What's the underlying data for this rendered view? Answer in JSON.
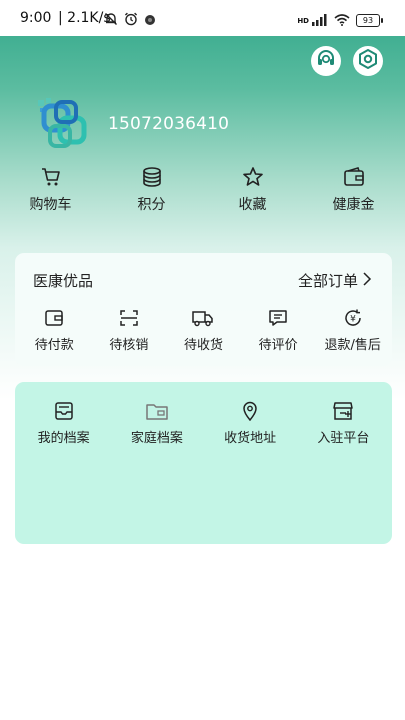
{
  "status_bar": {
    "time": "9:00",
    "speed": "| 2.1K/s",
    "network_label": "HD",
    "battery": "93"
  },
  "profile": {
    "phone": "15072036410"
  },
  "quick_links": [
    {
      "label": "购物车",
      "icon": "cart-icon"
    },
    {
      "label": "积分",
      "icon": "coins-icon"
    },
    {
      "label": "收藏",
      "icon": "star-icon"
    },
    {
      "label": "健康金",
      "icon": "wallet-icon"
    }
  ],
  "orders": {
    "title": "医康优品",
    "all_label": "全部订单",
    "items": [
      {
        "label": "待付款",
        "icon": "wallet-icon"
      },
      {
        "label": "待核销",
        "icon": "scan-icon"
      },
      {
        "label": "待收货",
        "icon": "truck-icon"
      },
      {
        "label": "待评价",
        "icon": "comment-icon"
      },
      {
        "label": "退款/售后",
        "icon": "refund-icon"
      }
    ]
  },
  "archive": {
    "items": [
      {
        "label": "我的档案",
        "icon": "inbox-icon"
      },
      {
        "label": "家庭档案",
        "icon": "folder-icon"
      },
      {
        "label": "收货地址",
        "icon": "location-pin-icon"
      },
      {
        "label": "入驻平台",
        "icon": "store-icon"
      }
    ]
  },
  "colors": {
    "header_gradient_top": "#2fa688",
    "archive_card": "#c3f5e6"
  }
}
